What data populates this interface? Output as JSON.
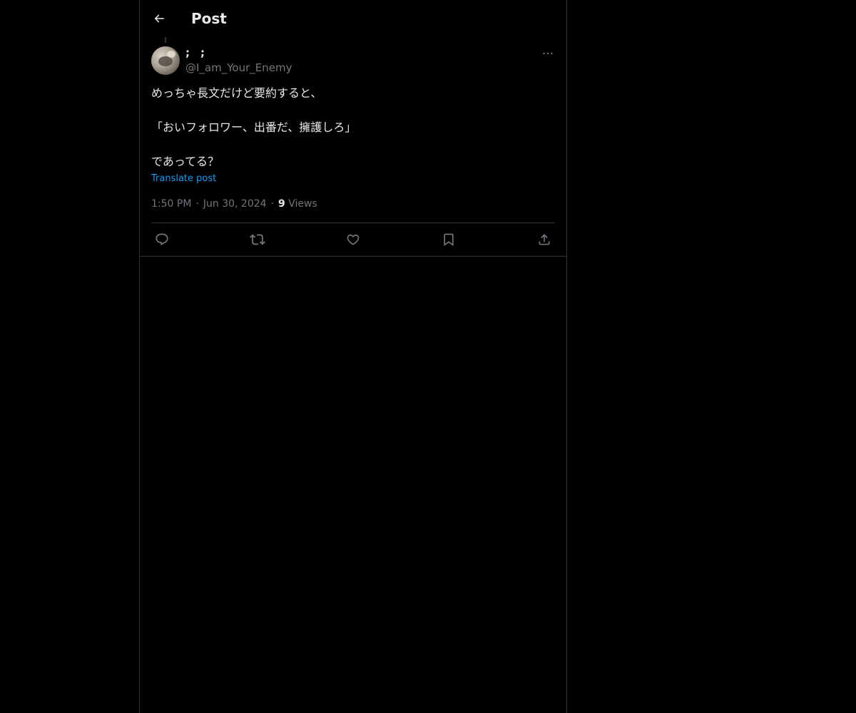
{
  "header": {
    "title": "Post",
    "back_icon": "arrow-left-icon"
  },
  "post": {
    "author": {
      "display_name": ";　;",
      "handle": "@I_am_Your_Enemy"
    },
    "body_lines": [
      "めっちゃ長文だけど要約すると、",
      "",
      "「おいフォロワー、出番だ、擁護しろ」",
      "",
      "であってる？"
    ],
    "translate_label": "Translate post",
    "time": "1:50 PM",
    "date": "Jun 30, 2024",
    "views_count": "9",
    "views_label": "Views"
  },
  "actions": [
    {
      "name": "reply",
      "icon": "reply-icon"
    },
    {
      "name": "repost",
      "icon": "repost-icon"
    },
    {
      "name": "like",
      "icon": "heart-icon"
    },
    {
      "name": "bookmark",
      "icon": "bookmark-icon"
    },
    {
      "name": "share",
      "icon": "share-icon"
    }
  ],
  "colors": {
    "background": "#000000",
    "text": "#e7e9ea",
    "muted": "#71767b",
    "link": "#1d9bf0",
    "border": "#2f3336"
  }
}
